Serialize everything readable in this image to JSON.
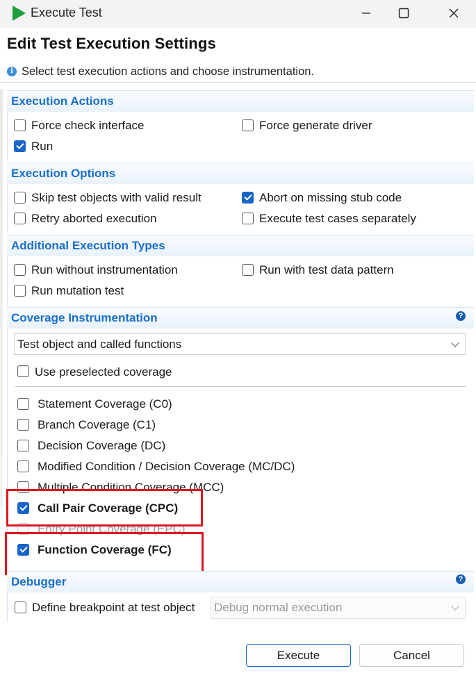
{
  "window": {
    "title": "Execute Test"
  },
  "header": {
    "title": "Edit Test Execution Settings",
    "info": "Select test execution actions and choose instrumentation."
  },
  "execution_actions": {
    "title": "Execution Actions",
    "force_check_interface": "Force check interface",
    "force_generate_driver": "Force generate driver",
    "run": "Run"
  },
  "execution_options": {
    "title": "Execution Options",
    "skip_valid": "Skip test objects with valid result",
    "abort_missing_stub": "Abort on missing stub code",
    "retry_aborted": "Retry aborted execution",
    "execute_separately": "Execute test cases separately"
  },
  "additional_types": {
    "title": "Additional Execution Types",
    "run_without_instr": "Run without instrumentation",
    "run_with_pattern": "Run with test data pattern",
    "run_mutation": "Run mutation test"
  },
  "coverage": {
    "title": "Coverage Instrumentation",
    "selected": "Test object and called functions",
    "use_preselected": "Use preselected coverage",
    "items": {
      "c0": "Statement Coverage (C0)",
      "c1": "Branch Coverage (C1)",
      "dc": "Decision Coverage (DC)",
      "mcdc": "Modified Condition / Decision Coverage (MC/DC)",
      "mcc": "Multiple Condition Coverage (MCC)",
      "cpc": "Call Pair Coverage (CPC)",
      "epc": "Entry Point Coverage (EPC)",
      "fc": "Function Coverage (FC)"
    }
  },
  "debugger": {
    "title": "Debugger",
    "define_breakpoint": "Define breakpoint at test object",
    "mode": "Debug normal execution"
  },
  "buttons": {
    "execute": "Execute",
    "cancel": "Cancel"
  },
  "colors": {
    "accent": "#1864c8",
    "section_title": "#1a6fc9",
    "highlight": "#e0141e",
    "play": "#1f9e3c"
  },
  "icons": [
    "play-icon",
    "minimize-icon",
    "maximize-icon",
    "close-icon",
    "info-icon",
    "help-icon",
    "chevron-down-icon",
    "checkmark-icon"
  ]
}
